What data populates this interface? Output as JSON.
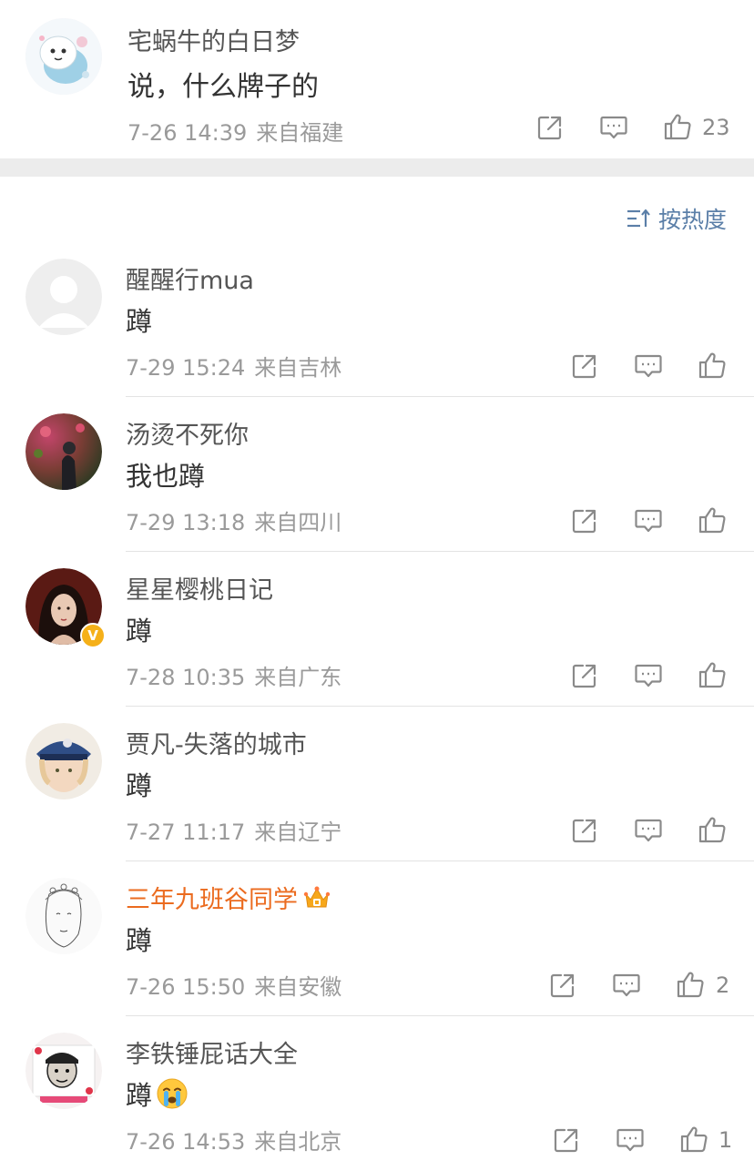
{
  "top_comment": {
    "username": "宅蜗牛的白日梦",
    "text": "说，什么牌子的",
    "time": "7-26 14:39",
    "location": "来自福建",
    "likes": "23"
  },
  "sort": {
    "label": "按热度"
  },
  "replies": [
    {
      "username": "醒醒行mua",
      "text": "蹲",
      "time": "7-29 15:24",
      "location": "来自吉林",
      "likes": ""
    },
    {
      "username": "汤烫不死你",
      "text": "我也蹲",
      "time": "7-29 13:18",
      "location": "来自四川",
      "likes": ""
    },
    {
      "username": "星星樱桃日记",
      "text": "蹲",
      "time": "7-28 10:35",
      "location": "来自广东",
      "likes": "",
      "verified_badge": "V"
    },
    {
      "username": "贾凡-失落的城市",
      "text": "蹲",
      "time": "7-27 11:17",
      "location": "来自辽宁",
      "likes": ""
    },
    {
      "username": "三年九班谷同学",
      "text": "蹲",
      "time": "7-26 15:50",
      "location": "来自安徽",
      "likes": "2"
    },
    {
      "username": "李铁锤屁话大全",
      "text": "蹲",
      "time": "7-26 14:53",
      "location": "来自北京",
      "likes": "1"
    }
  ],
  "colors": {
    "vip_username": "#eb6b1f",
    "link_blue": "#5b7fa8",
    "divider": "#ececec",
    "verified_badge": "#f5b019"
  },
  "icons": {
    "share": "share-icon",
    "comment": "comment-icon",
    "like": "like-icon",
    "sort": "sort-icon",
    "crown": "crown-icon",
    "cry_emoji": "crying-emoji-icon"
  }
}
